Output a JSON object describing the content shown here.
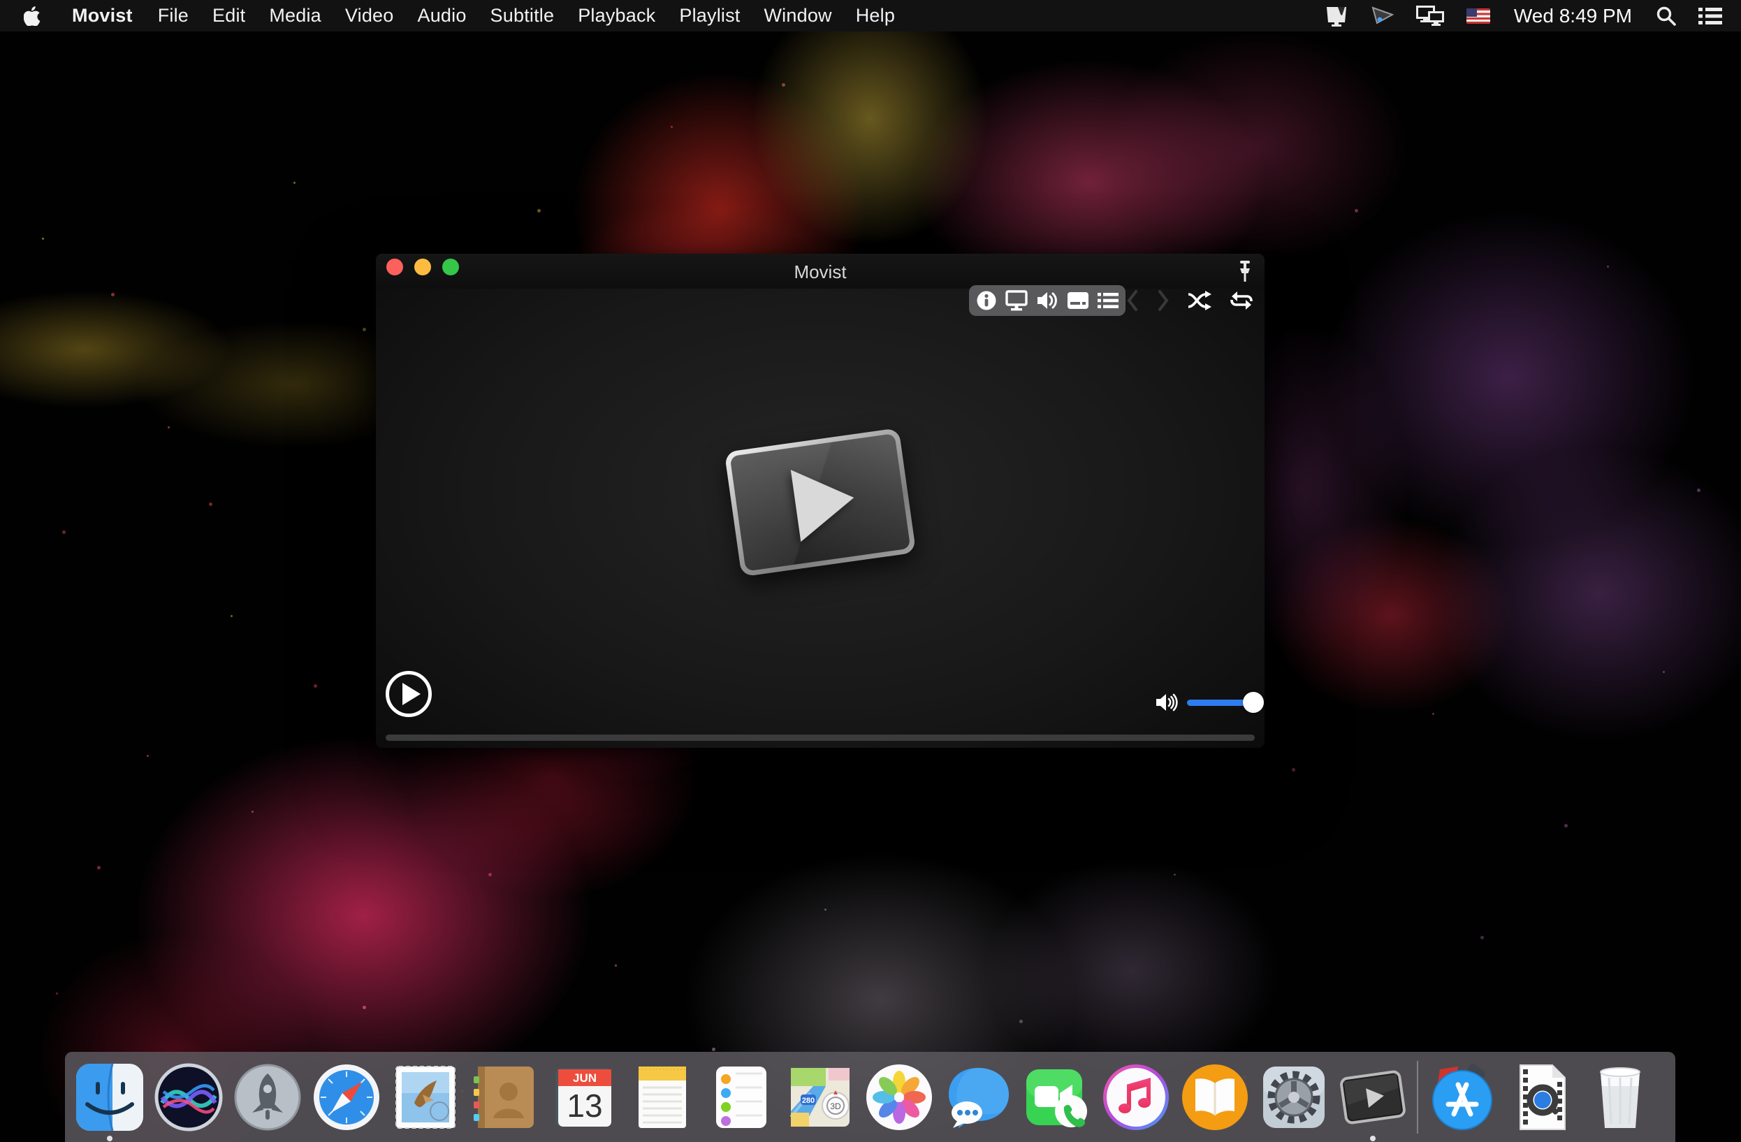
{
  "menubar": {
    "apple_logo": "apple-logo",
    "items": [
      "Movist",
      "File",
      "Edit",
      "Media",
      "Video",
      "Audio",
      "Subtitle",
      "Playback",
      "Playlist",
      "Window",
      "Help"
    ],
    "status": {
      "icons": [
        "display-corner",
        "projector",
        "display-mirroring",
        "input-source-us-flag"
      ],
      "clock": "Wed 8:49 PM",
      "spotlight": "Spotlight search",
      "notification_center": "Notification Center"
    }
  },
  "window": {
    "title": "Movist",
    "traffic_lights": [
      "close",
      "minimize",
      "zoom"
    ],
    "toolbar": {
      "icons": [
        "Media info",
        "Video",
        "Audio",
        "Subtitle",
        "Playlist"
      ]
    },
    "transport": {
      "prev": "Previous",
      "next": "Next",
      "shuffle": "Shuffle",
      "repeat": "Repeat",
      "pin": "Pin window"
    },
    "controls": {
      "play": "Play",
      "volume_level_percent": 100,
      "progress_percent": 0
    },
    "colors": {
      "volume_accent": "#2e7cf0",
      "close": "#fc615d",
      "minimize": "#fdbc40",
      "zoom": "#34c749"
    }
  },
  "dock": {
    "items": [
      {
        "name": "finder",
        "running": true
      },
      {
        "name": "siri"
      },
      {
        "name": "launchpad"
      },
      {
        "name": "safari"
      },
      {
        "name": "mail"
      },
      {
        "name": "contacts"
      },
      {
        "name": "calendar"
      },
      {
        "name": "notes"
      },
      {
        "name": "reminders"
      },
      {
        "name": "maps"
      },
      {
        "name": "photos"
      },
      {
        "name": "messages"
      },
      {
        "name": "facetime"
      },
      {
        "name": "itunes"
      },
      {
        "name": "ibooks"
      },
      {
        "name": "system-preferences"
      },
      {
        "name": "movist",
        "running": true
      },
      {
        "name": "app-store"
      },
      {
        "name": "quicktime-document"
      },
      {
        "name": "trash"
      }
    ],
    "calendar": {
      "month": "JUN",
      "day": "13"
    },
    "maps": {
      "shield": "280",
      "badge": "3D"
    }
  }
}
